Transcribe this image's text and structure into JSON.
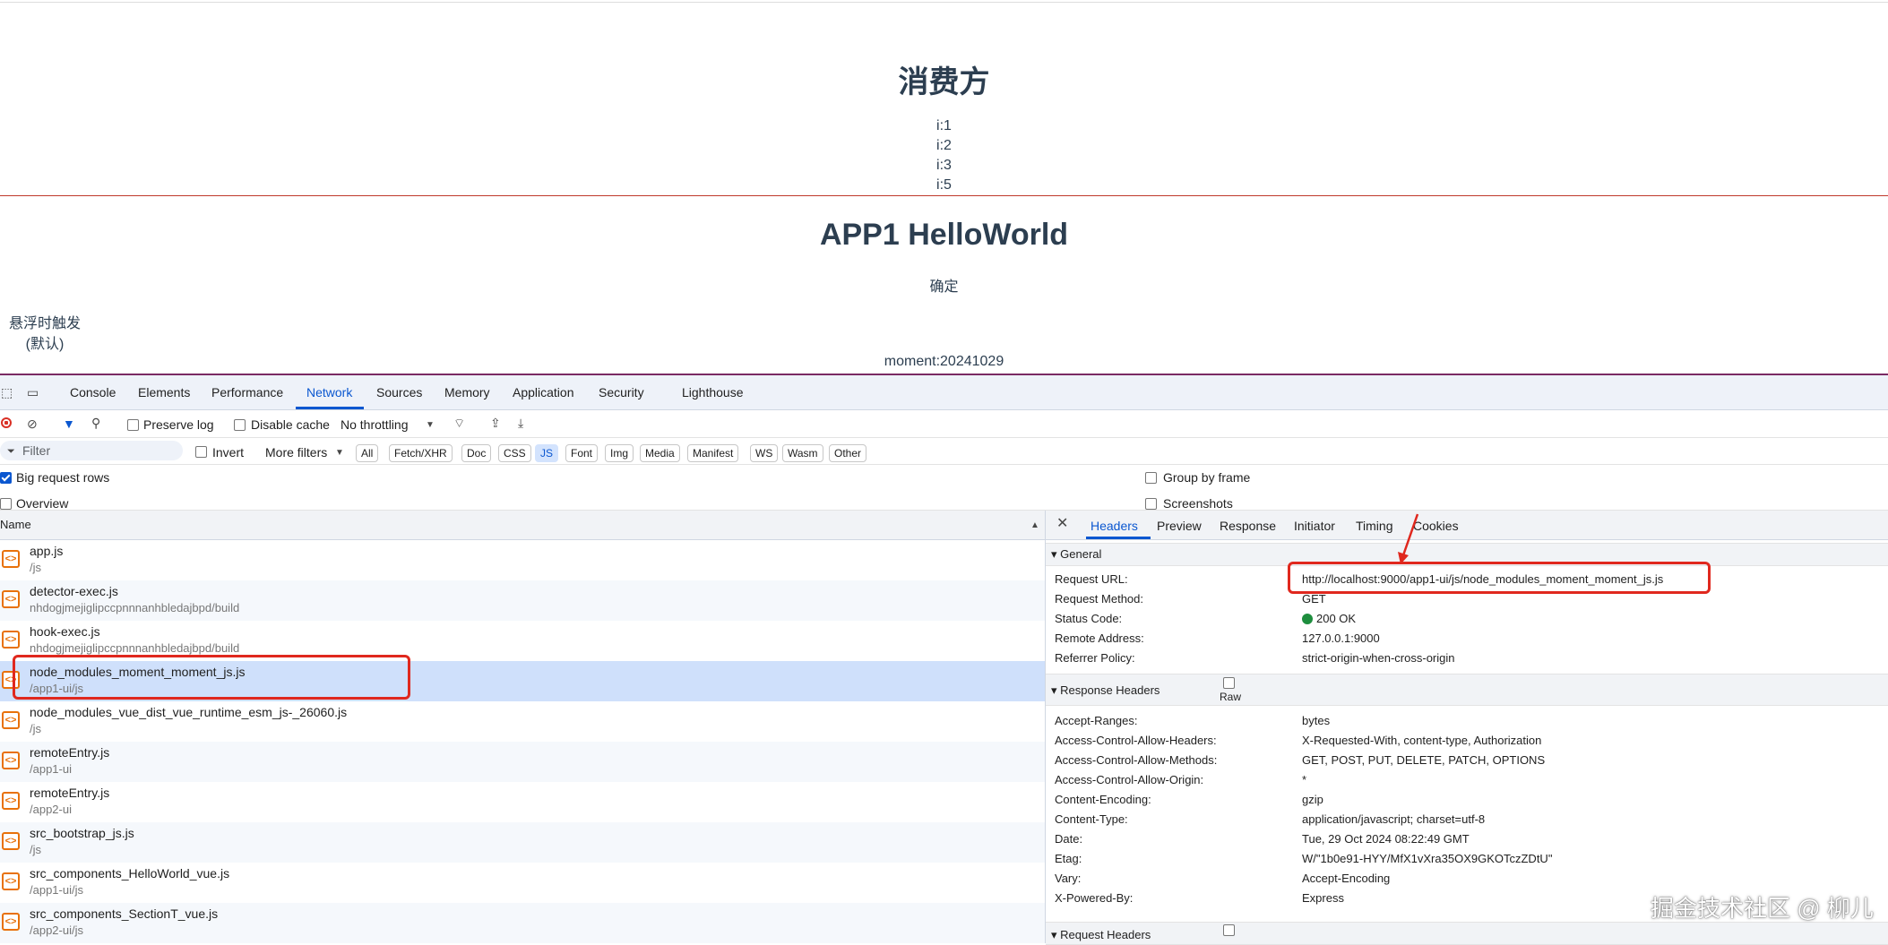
{
  "page": {
    "consumer_title": "消费方",
    "i_items": [
      "i:1",
      "i:2",
      "i:3",
      "i:5"
    ],
    "app_title": "APP1 HelloWorld",
    "confirm_label": "确定",
    "hover_line1": "悬浮时触发",
    "hover_line2": "(默认)",
    "moment_text": "moment:20241029"
  },
  "devtools": {
    "tabs": [
      "Console",
      "Elements",
      "Performance",
      "Network",
      "Sources",
      "Memory",
      "Application",
      "Security",
      "Lighthouse"
    ],
    "active_tab": "Network",
    "toolbar": {
      "preserve_log": "Preserve log",
      "disable_cache": "Disable cache",
      "throttling": "No throttling"
    },
    "filter": {
      "placeholder": "Filter",
      "invert": "Invert",
      "more_filters": "More filters",
      "chips": [
        "All",
        "Fetch/XHR",
        "Doc",
        "CSS",
        "JS",
        "Font",
        "Img",
        "Media",
        "Manifest",
        "WS",
        "Wasm",
        "Other"
      ],
      "active_chip": "JS"
    },
    "options": {
      "big_request_rows": "Big request rows",
      "overview": "Overview",
      "group_by_frame": "Group by frame",
      "screenshots": "Screenshots"
    },
    "list": {
      "column_name": "Name",
      "rows": [
        {
          "name": "app.js",
          "path": "/js"
        },
        {
          "name": "detector-exec.js",
          "path": "nhdogjmejiglipccpnnnanhbledajbpd/build"
        },
        {
          "name": "hook-exec.js",
          "path": "nhdogjmejiglipccpnnnanhbledajbpd/build"
        },
        {
          "name": "node_modules_moment_moment_js.js",
          "path": "/app1-ui/js"
        },
        {
          "name": "node_modules_vue_dist_vue_runtime_esm_js-_26060.js",
          "path": "/js"
        },
        {
          "name": "remoteEntry.js",
          "path": "/app1-ui"
        },
        {
          "name": "remoteEntry.js",
          "path": "/app2-ui"
        },
        {
          "name": "src_bootstrap_js.js",
          "path": "/js"
        },
        {
          "name": "src_components_HelloWorld_vue.js",
          "path": "/app1-ui/js"
        },
        {
          "name": "src_components_SectionT_vue.js",
          "path": "/app2-ui/js"
        }
      ]
    },
    "panel": {
      "tabs": [
        "Headers",
        "Preview",
        "Response",
        "Initiator",
        "Timing",
        "Cookies"
      ],
      "active_tab": "Headers",
      "general_title": "General",
      "general": [
        {
          "k": "Request URL:",
          "v": "http://localhost:9000/app1-ui/js/node_modules_moment_moment_js.js"
        },
        {
          "k": "Request Method:",
          "v": "GET"
        },
        {
          "k": "Status Code:",
          "v": "200 OK"
        },
        {
          "k": "Remote Address:",
          "v": "127.0.0.1:9000"
        },
        {
          "k": "Referrer Policy:",
          "v": "strict-origin-when-cross-origin"
        }
      ],
      "response_title": "Response Headers",
      "raw_label": "Raw",
      "response": [
        {
          "k": "Accept-Ranges:",
          "v": "bytes"
        },
        {
          "k": "Access-Control-Allow-Headers:",
          "v": "X-Requested-With, content-type, Authorization"
        },
        {
          "k": "Access-Control-Allow-Methods:",
          "v": "GET, POST, PUT, DELETE, PATCH, OPTIONS"
        },
        {
          "k": "Access-Control-Allow-Origin:",
          "v": "*"
        },
        {
          "k": "Content-Encoding:",
          "v": "gzip"
        },
        {
          "k": "Content-Type:",
          "v": "application/javascript; charset=utf-8"
        },
        {
          "k": "Date:",
          "v": "Tue, 29 Oct 2024 08:22:49 GMT"
        },
        {
          "k": "Etag:",
          "v": "W/\"1b0e91-HYY/MfX1vXra35OX9GKOTczZDtU\""
        },
        {
          "k": "Vary:",
          "v": "Accept-Encoding"
        },
        {
          "k": "X-Powered-By:",
          "v": "Express"
        }
      ],
      "request_title": "Request Headers"
    }
  },
  "watermark": "掘金技术社区 @ 柳儿"
}
